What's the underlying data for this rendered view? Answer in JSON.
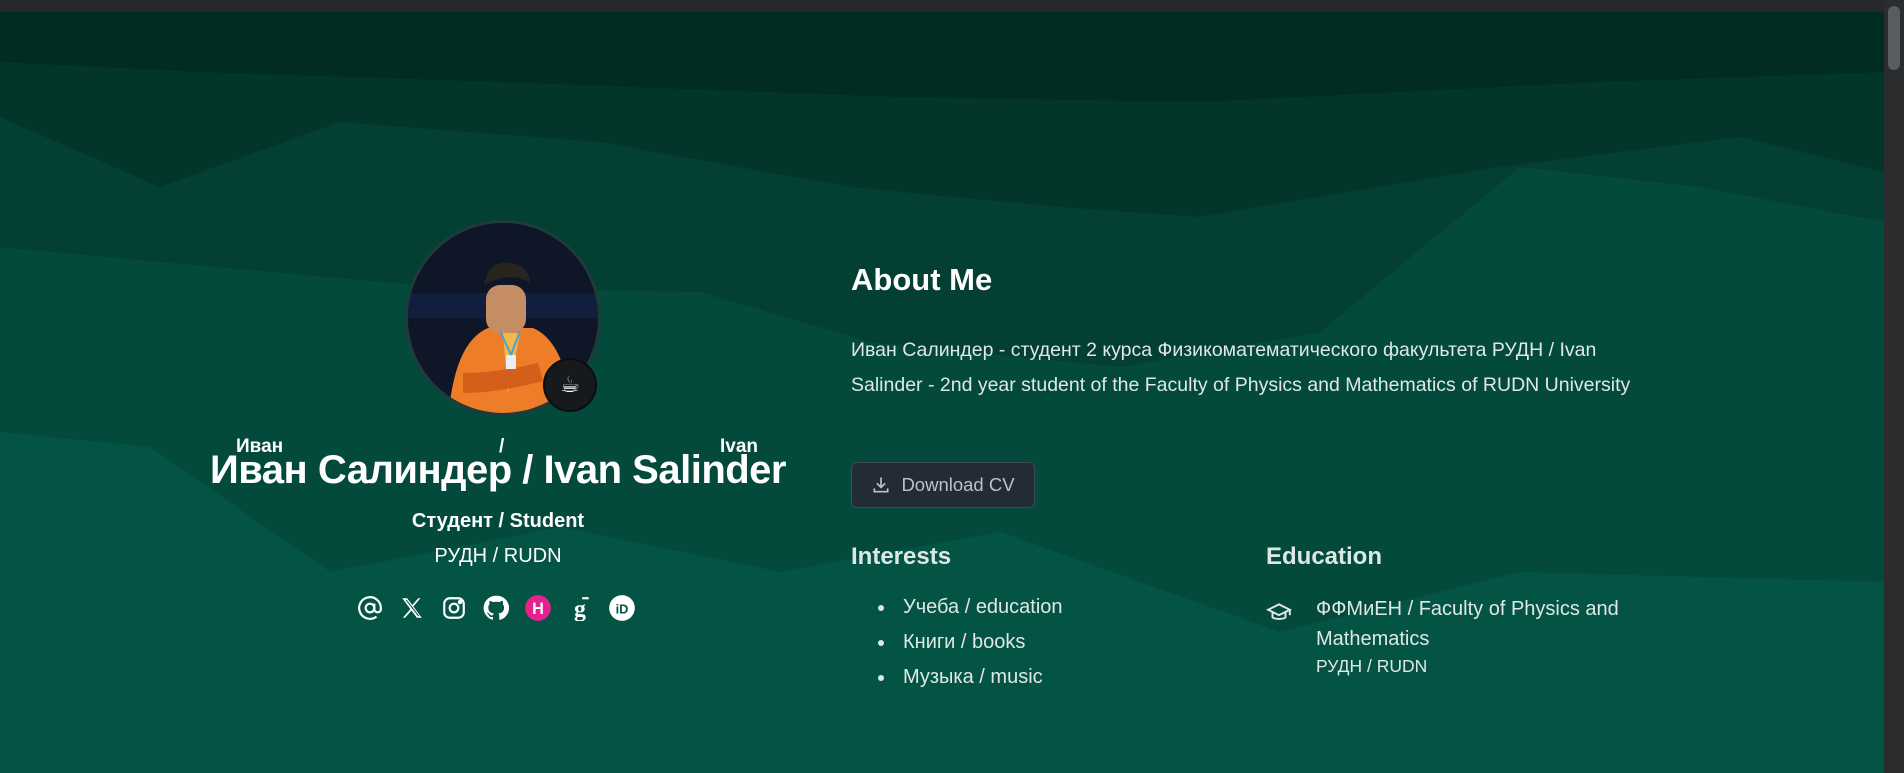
{
  "colors": {
    "accent": "#045446",
    "card_bg": "#232b36",
    "text": "#dfe8e4"
  },
  "profile": {
    "avatar_alt": "Иван Салиндер / Ivan Salinder",
    "name_parts": [
      "Иван",
      "/",
      "Ivan"
    ],
    "name": "Иван Салиндер / Ivan Salinder",
    "role": "Студент / Student",
    "organization": "РУДН / RUDN",
    "social_icons": [
      "at-email-icon",
      "x-twitter-icon",
      "instagram-icon",
      "github-icon",
      "hashnode-icon",
      "google-scholar-icon",
      "orcid-icon"
    ]
  },
  "about": {
    "title": "About Me",
    "text": "Иван Салиндер - студент 2 курса Физикоматематического факультета РУДН / Ivan Salinder - 2nd year student of the Faculty of Physics and Mathematics of RUDN University",
    "download_cv_label": "Download CV"
  },
  "interests": {
    "title": "Interests",
    "items": [
      "Учеба / education",
      "Книги / books",
      "Музыка / music"
    ]
  },
  "education": {
    "title": "Education",
    "items": [
      {
        "degree": "ФФМиЕН / Faculty of Physics and Mathematics",
        "institution": "РУДН / RUDN"
      }
    ]
  }
}
